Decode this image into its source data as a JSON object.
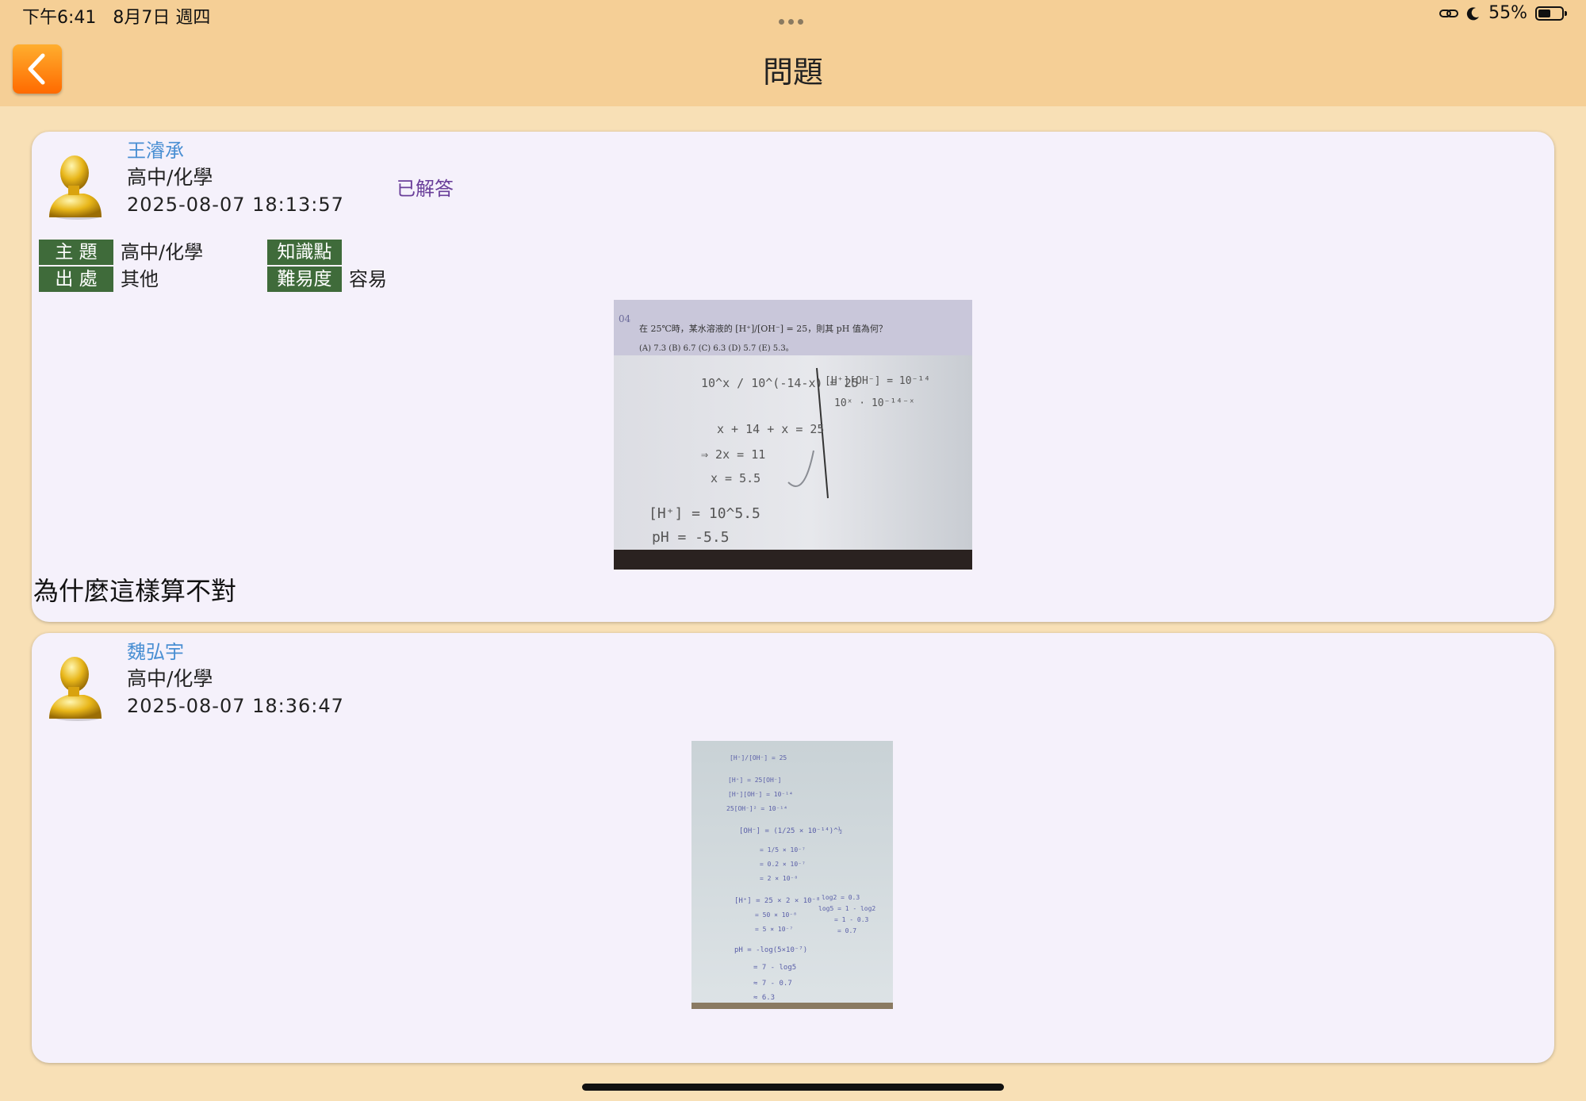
{
  "status_bar": {
    "time": "下午6:41",
    "date": "8月7日 週四",
    "battery": "55%",
    "battery_level": 0.55
  },
  "nav": {
    "title": "問題",
    "back_icon": "chevron-left-icon"
  },
  "question": {
    "user_name": "王濬承",
    "category": "高中/化學",
    "timestamp": "2025-08-07 18:13:57",
    "status": "已解答",
    "tags": [
      {
        "label": "主 題",
        "value": "高中/化學"
      },
      {
        "label": "出 處",
        "value": "其他"
      },
      {
        "label": "知識點",
        "value": ""
      },
      {
        "label": "難易度",
        "value": "容易"
      }
    ],
    "photo": {
      "problem_number": "04",
      "problem_text": "在 25℃時，某水溶液的 [H⁺]/[OH⁻] = 25，則其 pH 值為何？",
      "choices": "(A) 7.3   (B) 6.7   (C) 6.3   (D) 5.7   (E) 5.3。",
      "work_lines": [
        "10^x / 10^(-14-x) = 25",
        "x + 14 + x = 25",
        "⇒ 2x = 11",
        "x = 5.5",
        "[H⁺] = 10^5.5",
        "pH = -5.5"
      ],
      "side_lines": [
        "[H⁺][OH⁻] = 10⁻¹⁴",
        "10ˣ · 10⁻¹⁴⁻ˣ"
      ]
    },
    "text": "為什麼這樣算不對"
  },
  "answer": {
    "user_name": "魏弘宇",
    "category": "高中/化學",
    "timestamp": "2025-08-07 18:36:47",
    "photo": {
      "work_lines": [
        "[H⁺]/[OH⁻] = 25",
        "[H⁺] = 25[OH⁻]",
        "[H⁺][OH⁻] = 10⁻¹⁴",
        "25[OH⁻]² = 10⁻¹⁴",
        "[OH⁻] = (1/25 × 10⁻¹⁴)^½",
        "= 1/5 × 10⁻⁷",
        "= 0.2 × 10⁻⁷",
        "= 2 × 10⁻⁸",
        "[H⁺] = 25 × 2 × 10⁻⁸",
        "= 50 × 10⁻⁸",
        "= 5 × 10⁻⁷",
        "pH = -log(5×10⁻⁷)",
        "= 7 - log5",
        "≈ 7 - 0.7",
        "≈ 6.3"
      ],
      "side_lines": [
        "log2 = 0.3",
        "log5 = 1 - log2",
        "= 1 - 0.3",
        "= 0.7"
      ]
    }
  },
  "colors": {
    "background": "#f8e0b6",
    "bar": "#f5cf96",
    "card": "#f5f1fb",
    "tag": "#3f6b3a",
    "user_name": "#4a8fd3",
    "status": "#6a3f9a"
  }
}
